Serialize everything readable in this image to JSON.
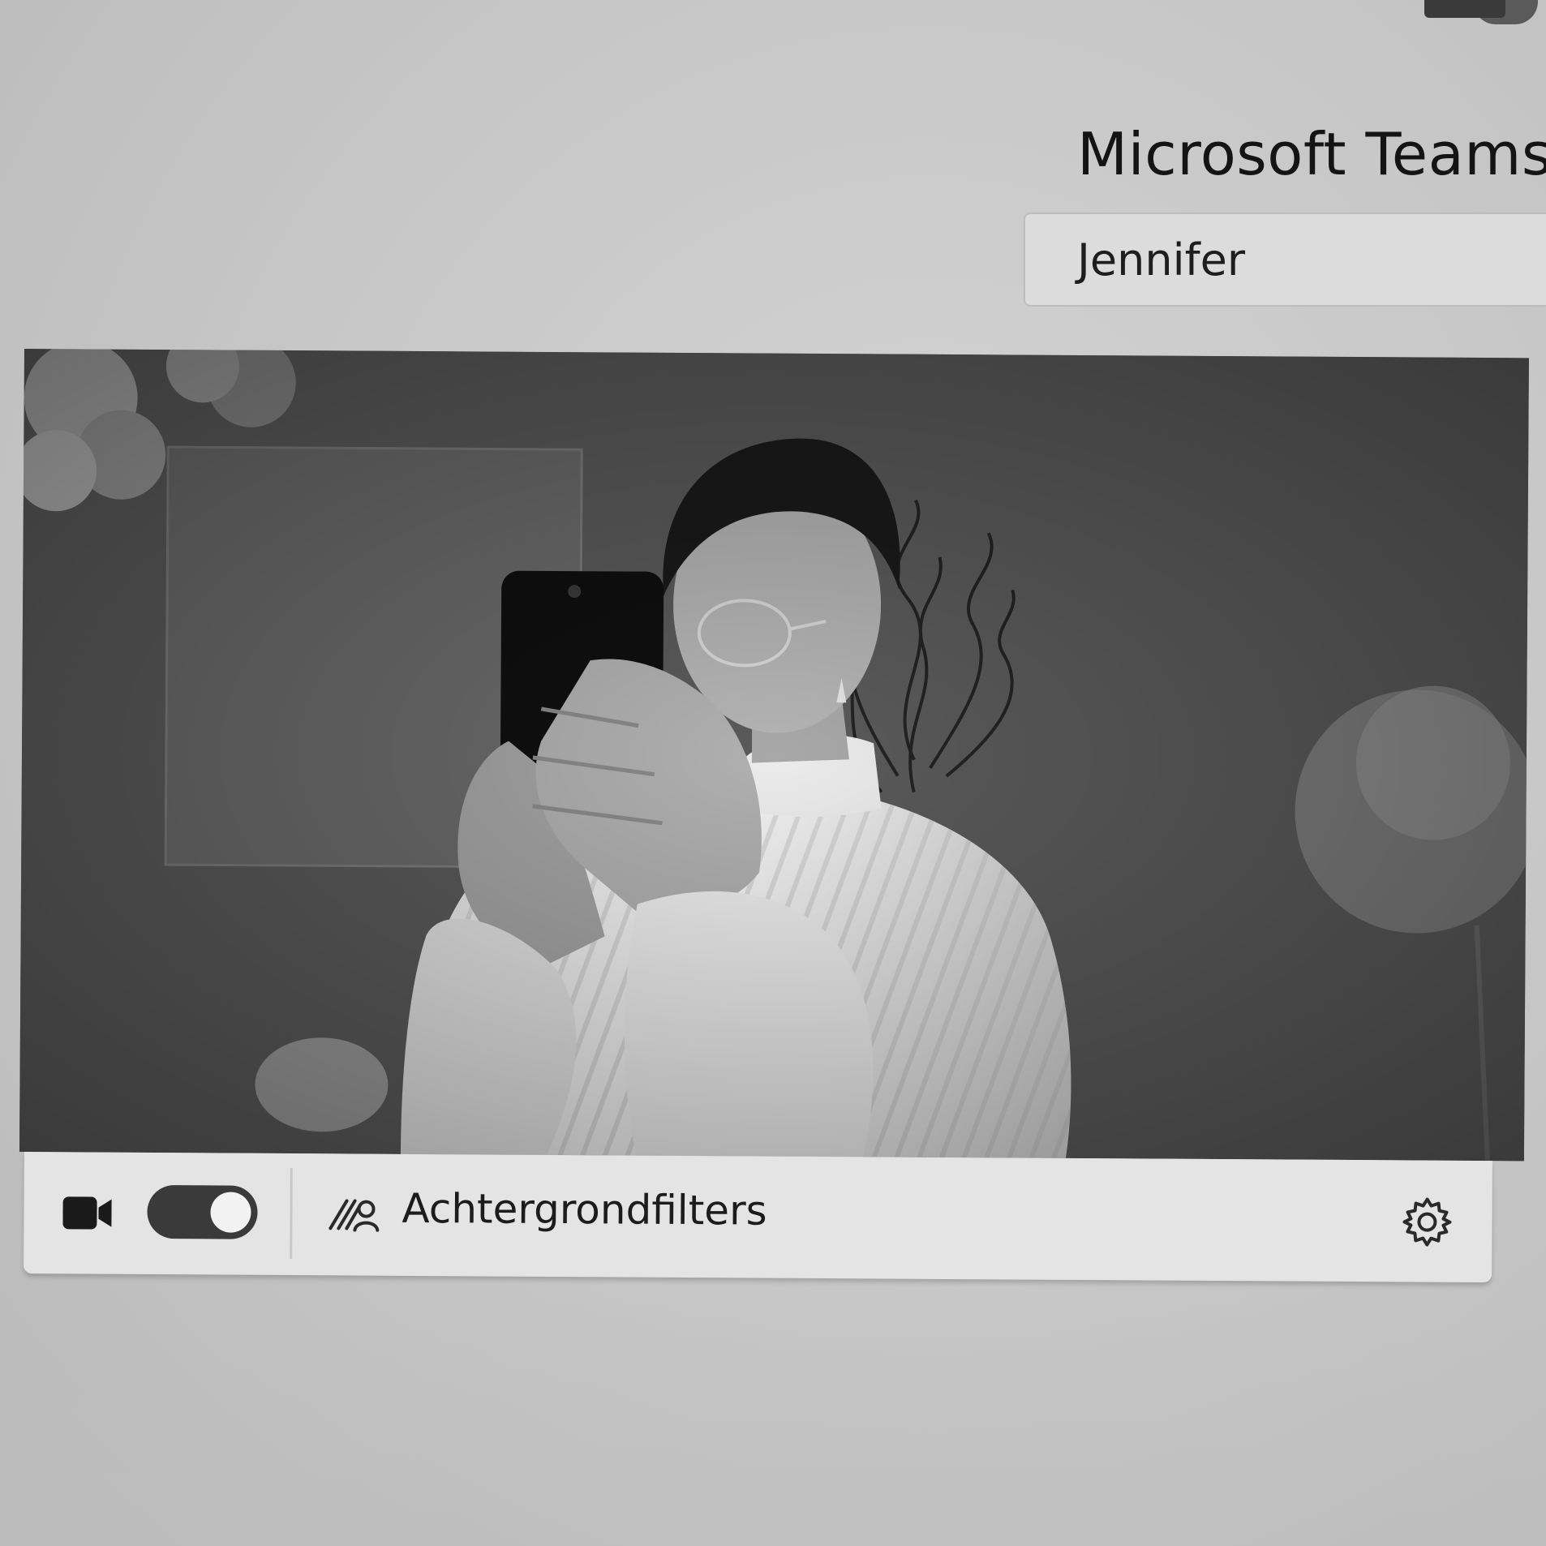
{
  "window": {
    "title": "Microsoft Teams-"
  },
  "join": {
    "name_value": "Jennifer"
  },
  "preview": {
    "camera_on": true,
    "background_filters_label": "Achtergrondfilters"
  },
  "icons": {
    "camera": "camera-icon",
    "background_filters": "background-filters-icon",
    "settings": "gear-icon",
    "app": "teams-logo-icon"
  }
}
